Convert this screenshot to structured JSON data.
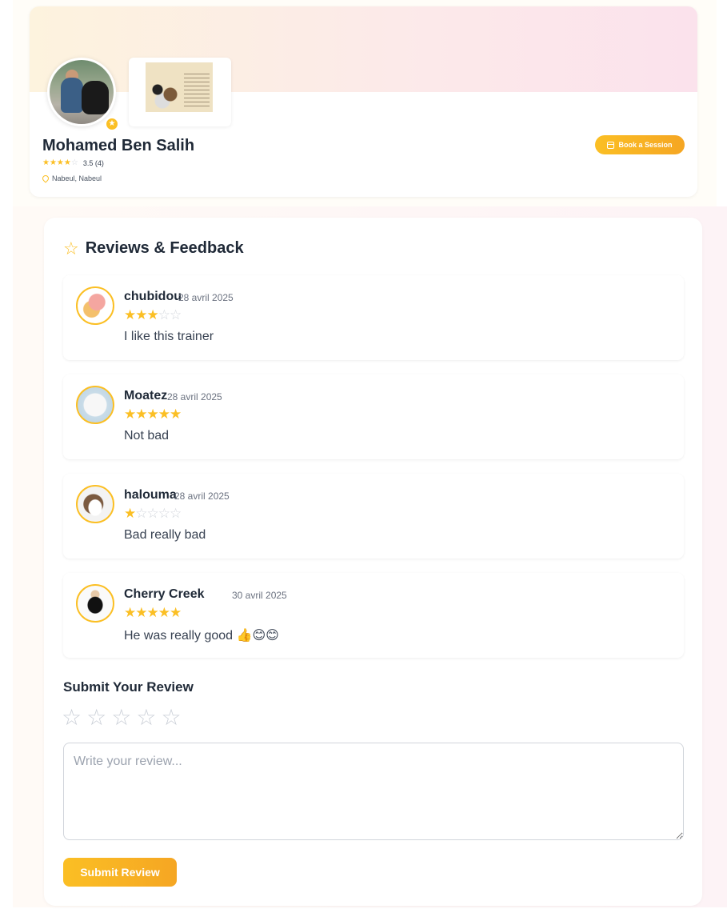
{
  "profile": {
    "name": "Mohamed Ben Salih",
    "rating_text": "3.5 (4)",
    "rating_value": 3.5,
    "location": "Nabeul, Nabeul",
    "book_button": "Book a Session"
  },
  "reviews_section": {
    "title": "Reviews & Feedback",
    "items": [
      {
        "name": "chubidou",
        "date": "28 avril 2025",
        "rating": 3,
        "text": "I like this trainer"
      },
      {
        "name": "Moatez",
        "date": "28 avril 2025",
        "rating": 5,
        "text": "Not bad"
      },
      {
        "name": "halouma",
        "date": "28 avril 2025",
        "rating": 1,
        "text": "Bad really bad"
      },
      {
        "name": "Cherry Creek",
        "date": "30 avril 2025",
        "rating": 5,
        "text": "He was really good 👍😊😊"
      }
    ]
  },
  "submit": {
    "title": "Submit Your Review",
    "placeholder": "Write your review...",
    "button": "Submit Review"
  },
  "colors": {
    "accent": "#fbbf24",
    "text": "#1f2937"
  }
}
